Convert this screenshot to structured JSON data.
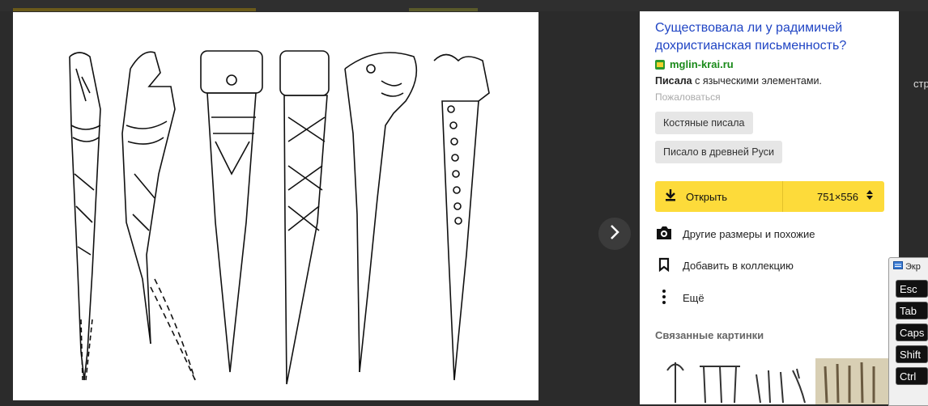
{
  "panel": {
    "title": "Существовала ли у радимичей дохристианская письменность?",
    "source": "mglin-krai.ru",
    "description_bold": "Писала",
    "description_rest": " с языческими элементами.",
    "complain": "Пожаловаться",
    "tags": [
      "Костяные писала",
      "Писало в древней Руси"
    ],
    "open": {
      "label": "Открыть",
      "size": "751×556"
    },
    "actions": [
      {
        "label": "Другие размеры и похожие",
        "icon": "camera-search-icon"
      },
      {
        "label": "Добавить в коллекцию",
        "icon": "bookmark-icon"
      },
      {
        "label": "Ещё",
        "icon": "more-vertical-icon"
      }
    ],
    "related_title": "Связанные картинки"
  },
  "side": {
    "cut_text": "стр"
  },
  "keyboard": {
    "title": "Экр",
    "keys": [
      "Esc",
      "Tab",
      "Caps",
      "Shift",
      "Ctrl"
    ]
  },
  "colors": {
    "accent": "#fddb3a",
    "link": "#2045c4",
    "source": "#1a8a1a"
  }
}
